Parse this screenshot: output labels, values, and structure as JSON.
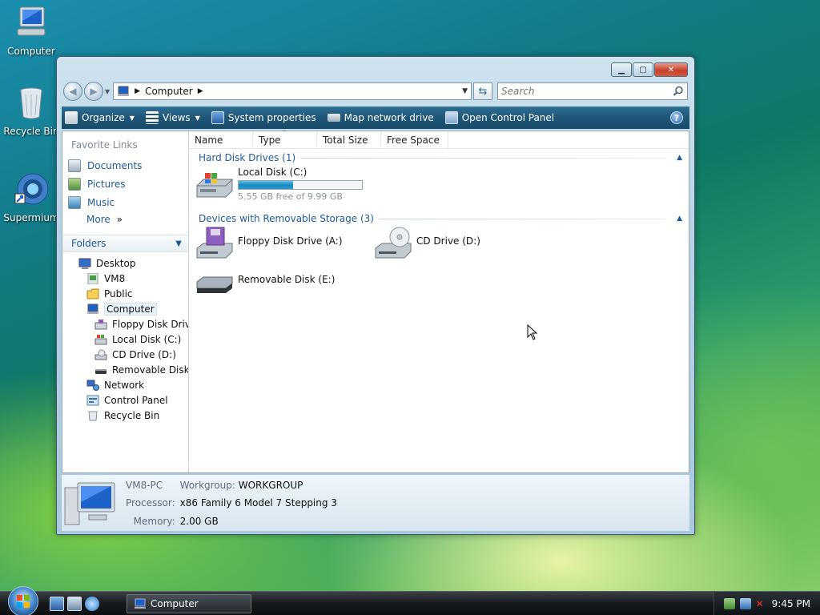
{
  "desktop": {
    "icons": [
      {
        "label": "Computer"
      },
      {
        "label": "Recycle Bin"
      },
      {
        "label": "Supermium"
      }
    ]
  },
  "window": {
    "address": {
      "crumb": "Computer"
    },
    "search": {
      "placeholder": "Search"
    },
    "toolbar": {
      "organize": "Organize",
      "views": "Views",
      "system_properties": "System properties",
      "map_network_drive": "Map network drive",
      "open_control_panel": "Open Control Panel"
    },
    "nav": {
      "favorite_links_title": "Favorite Links",
      "favorites": [
        "Documents",
        "Pictures",
        "Music"
      ],
      "more": "More",
      "folders": "Folders",
      "tree": [
        {
          "label": "Desktop"
        },
        {
          "label": "VM8"
        },
        {
          "label": "Public"
        },
        {
          "label": "Computer"
        },
        {
          "label": "Floppy Disk Drive"
        },
        {
          "label": "Local Disk (C:)"
        },
        {
          "label": "CD Drive (D:)"
        },
        {
          "label": "Removable Disk (E"
        },
        {
          "label": "Network"
        },
        {
          "label": "Control Panel"
        },
        {
          "label": "Recycle Bin"
        }
      ]
    },
    "columns": [
      "Name",
      "Type",
      "Total Size",
      "Free Space"
    ],
    "groups": {
      "hdd": {
        "title": "Hard Disk Drives (1)",
        "items": [
          {
            "name": "Local Disk (C:)",
            "free_text": "5.55 GB free of 9.99 GB",
            "used_fraction": 0.44
          }
        ]
      },
      "removable": {
        "title": "Devices with Removable Storage (3)",
        "items": [
          {
            "name": "Floppy Disk Drive (A:)"
          },
          {
            "name": "CD Drive (D:)"
          },
          {
            "name": "Removable Disk (E:)"
          }
        ]
      }
    },
    "details": {
      "pc_name": "VM8-PC",
      "workgroup_label": "Workgroup:",
      "workgroup": "WORKGROUP",
      "processor_label": "Processor:",
      "processor": "x86 Family 6 Model 7 Stepping 3",
      "memory_label": "Memory:",
      "memory": "2.00 GB"
    }
  },
  "taskbar": {
    "task": "Computer",
    "clock": "9:45 PM"
  },
  "colors": {
    "link": "#1e5b9a",
    "toolbar": "#1f5677",
    "progress": "#1e86c0"
  }
}
